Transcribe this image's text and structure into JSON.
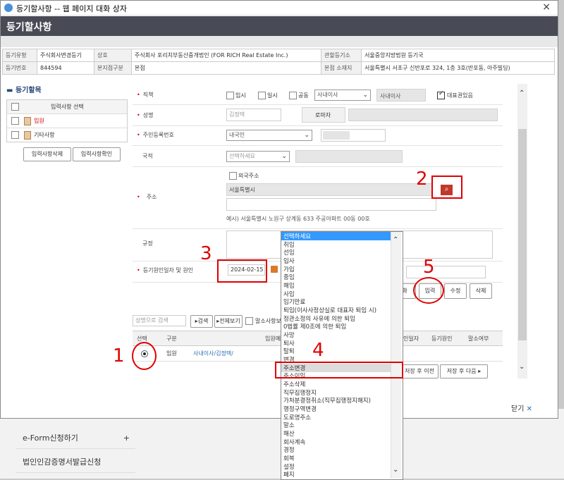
{
  "window": {
    "title": "등기할사항 -- 웹 페이지 대화 상자",
    "close": "×"
  },
  "header": {
    "title": "등기할사항"
  },
  "info": {
    "row1": [
      "등기유형",
      "주식회사변경등기",
      "상호",
      "주식회사 포리치부동산중개법인 (FOR RICH Real Estate Inc.)",
      "관할등기소",
      "서울중앙지방법원 등기국"
    ],
    "row2": [
      "등기번호",
      "844594",
      "본지점구분",
      "본점",
      "본점 소재지",
      "서울특별시 서초구 신반포로 324, 1층 3호(반포동, 아주빌딩)"
    ]
  },
  "left_panel": {
    "title": "등기할목",
    "header": "입력사항 선택",
    "items": [
      "임원",
      "기타사항"
    ],
    "btn_delete": "입력사항삭제",
    "btn_confirm": "입력사항확인"
  },
  "form": {
    "position": {
      "label": "직책",
      "opt1": "임시",
      "opt2": "일시",
      "opt3": "공동",
      "select": "사내이사",
      "value": "사내이사",
      "rep": "대표권있음"
    },
    "name": {
      "label": "성명",
      "value": "김정택",
      "roman_label": "로마자"
    },
    "rrn": {
      "label": "주민등록번호",
      "select": "내국인"
    },
    "nationality": {
      "label": "국적",
      "select": "선택하세요"
    },
    "address": {
      "label": "주소",
      "foreign": "외국주소",
      "value": "서울특별시",
      "example": "예시) 서울특별시 노원구 상계동 633 주공아파트 00동 00호"
    },
    "rule": {
      "label": "규정"
    },
    "cause": {
      "label": "등기원인일자 및 원인",
      "date": "2024-02-15"
    },
    "buttons": {
      "partial": "화",
      "input": "입력",
      "edit": "수정",
      "delete": "삭제"
    }
  },
  "search": {
    "placeholder": "성명으로 검색",
    "search_btn": "▸검색",
    "all_btn": "▸전체보기",
    "check": "말소사항보기"
  },
  "result": {
    "headers": [
      "선택",
      "구분",
      "임원예",
      "인일자",
      "등기원인",
      "말소여부"
    ],
    "row": {
      "kind": "임원",
      "info": "사내이사/김정택/"
    },
    "prev": "저장 후 이전",
    "next": "저장 후 다음"
  },
  "dropdown": {
    "items": [
      "선택하세요",
      "취임",
      "선임",
      "입사",
      "가입",
      "중임",
      "해임",
      "사임",
      "임기만료",
      "퇴임(이사사정상실로 대표자 퇴임 시)",
      "정관소정의 사유에 의한 퇴임",
      "0법률 제0조에 의한 퇴임",
      "사망",
      "퇴사",
      "탈퇴",
      "변경",
      "주소변경",
      "주소이임",
      "주소삭제",
      "직무집행정지",
      "가처분결정취소(직무집행정지해지)",
      "행정구역변경",
      "도로명주소",
      "말소",
      "해산",
      "회사계속",
      "경정",
      "회복",
      "설정",
      "폐지"
    ]
  },
  "footer": {
    "close": "닫기"
  },
  "background": {
    "items": [
      "e-Form신청하기",
      "법인인감증명서발급신청"
    ],
    "plus": "+"
  },
  "annotations": [
    "1",
    "2",
    "3",
    "4",
    "5"
  ],
  "colors": {
    "header": "#484a55",
    "annotation": "#e00000",
    "highlight": "#3399ff"
  }
}
